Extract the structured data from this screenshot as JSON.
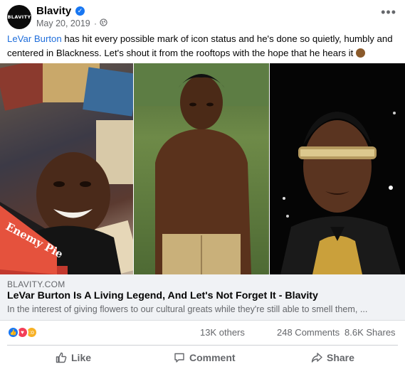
{
  "header": {
    "page_name": "Blavity",
    "avatar_text": "BLAVITY",
    "date": "May 20, 2019",
    "separator": "·"
  },
  "post": {
    "mention": "LeVar Burton",
    "text": " has hit every possible mark of icon status and he's done so quietly, humbly and centered in Blackness. Let's shout it from the rooftops with the hope that he hears it "
  },
  "link_preview": {
    "domain": "BLAVITY.COM",
    "title": "LeVar Burton Is A Living Legend, And Let's Not Forget It - Blavity",
    "description": "In the interest of giving flowers to our cultural greats while they're still able to smell them, ..."
  },
  "images": {
    "book_text": "Enemy Pie"
  },
  "stats": {
    "reactions": "13K others",
    "comments": "248 Comments",
    "shares": "8.6K Shares"
  },
  "actions": {
    "like": "Like",
    "comment": "Comment",
    "share": "Share"
  },
  "colors": {
    "link_blue": "#216fdb",
    "like_blue": "#1877f2",
    "love_red": "#f33e58",
    "wow_yellow": "#f7b125",
    "muted": "#65676b"
  }
}
